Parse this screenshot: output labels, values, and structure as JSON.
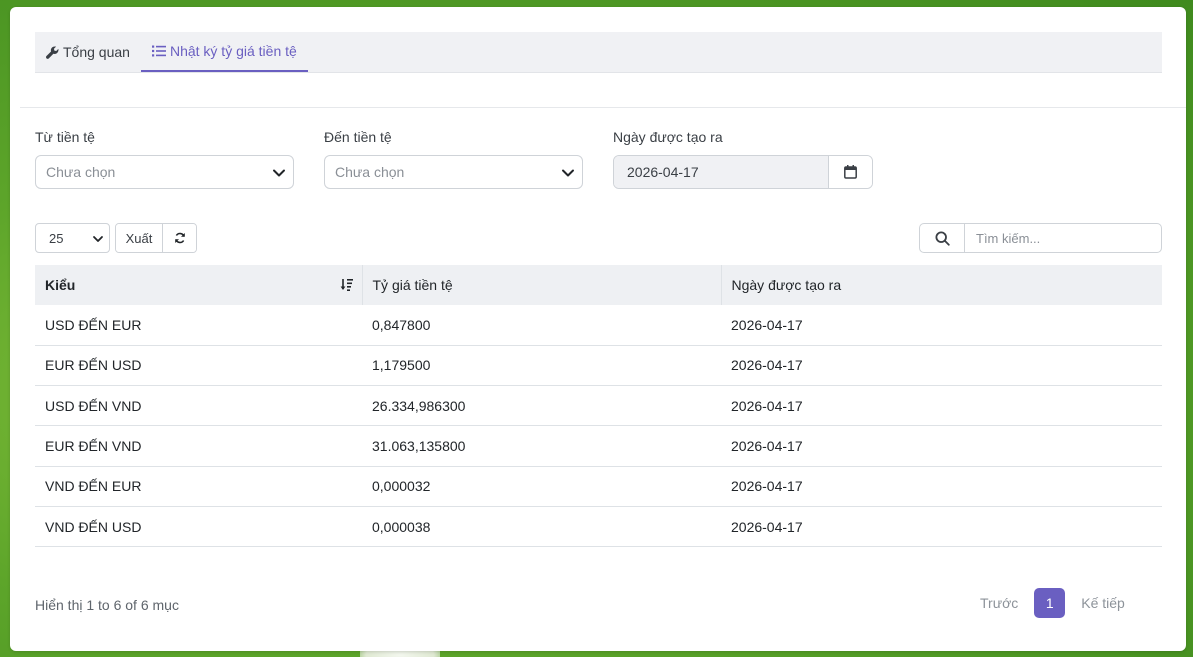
{
  "tabs": [
    {
      "label": "Tổng quan",
      "icon": "wrench-icon",
      "active": false
    },
    {
      "label": "Nhật ký tỷ giá tiền tệ",
      "icon": "list-icon",
      "active": true
    }
  ],
  "filters": {
    "from_currency": {
      "label": "Từ tiền tệ",
      "value": "Chưa chọn"
    },
    "to_currency": {
      "label": "Đến tiền tệ",
      "value": "Chưa chọn"
    },
    "created_date": {
      "label": "Ngày được tạo ra",
      "value": "2026-04-17"
    }
  },
  "toolbar": {
    "page_length": "25",
    "export_label": "Xuất",
    "search_placeholder": "Tìm kiếm..."
  },
  "table": {
    "headers": [
      "Kiểu",
      "Tỷ giá tiền tệ",
      "Ngày được tạo ra"
    ],
    "rows": [
      [
        "USD ĐẾN EUR",
        "0,847800",
        "2026-04-17"
      ],
      [
        "EUR ĐẾN USD",
        "1,179500",
        "2026-04-17"
      ],
      [
        "USD ĐẾN VND",
        "26.334,986300",
        "2026-04-17"
      ],
      [
        "EUR ĐẾN VND",
        "31.063,135800",
        "2026-04-17"
      ],
      [
        "VND ĐẾN EUR",
        "0,000032",
        "2026-04-17"
      ],
      [
        "VND ĐẾN USD",
        "0,000038",
        "2026-04-17"
      ]
    ]
  },
  "footer": {
    "info": "Hiển thị 1 to 6 of 6 mục",
    "prev_label": "Trước",
    "current_page": "1",
    "next_label": "Kế tiếp"
  },
  "colors": {
    "accent": "#6a5fc1",
    "tab_bg": "#f0f1f4",
    "background": "#5da52a"
  }
}
